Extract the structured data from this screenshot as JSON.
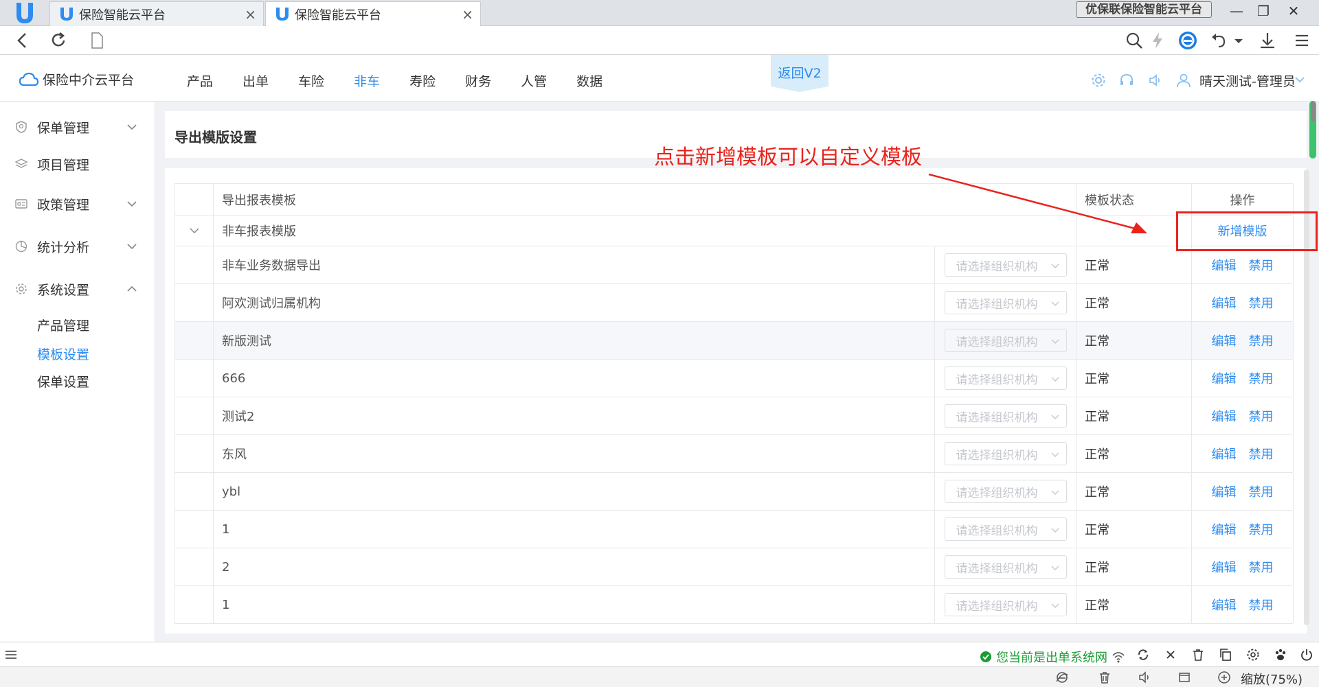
{
  "browser": {
    "tabs": [
      {
        "title": "保险智能云平台",
        "close": "×"
      },
      {
        "title": "保险智能云平台",
        "close": "×"
      }
    ],
    "app_title": "优保联保险智能云平台",
    "window_controls": {
      "minimize": "—",
      "maximize": "❐",
      "close": "✕"
    }
  },
  "header": {
    "brand": "保险中介云平台",
    "nav": [
      "产品",
      "出单",
      "车险",
      "非车",
      "寿险",
      "财务",
      "人管",
      "数据"
    ],
    "active_nav": "非车",
    "return_label": "返回V2",
    "user": "晴天测试-管理员"
  },
  "sidebar": {
    "items": [
      {
        "label": "保单管理",
        "icon": "shield-icon"
      },
      {
        "label": "项目管理",
        "icon": "layers-icon"
      },
      {
        "label": "政策管理",
        "icon": "policy-icon"
      },
      {
        "label": "统计分析",
        "icon": "pie-chart-icon"
      },
      {
        "label": "系统设置",
        "icon": "gear-icon"
      }
    ],
    "sub_items": [
      "产品管理",
      "模板设置",
      "保单设置"
    ],
    "active_sub": "模板设置"
  },
  "page": {
    "title": "导出模版设置",
    "annotation": "点击新增模板可以自定义模板"
  },
  "table": {
    "headers": {
      "name": "导出报表模板",
      "status": "模板状态",
      "ops": "操作"
    },
    "group": {
      "name": "非车报表模版",
      "add_label": "新增模版"
    },
    "select_placeholder": "请选择组织机构",
    "edit_label": "编辑",
    "disable_label": "禁用",
    "rows": [
      {
        "name": "非车业务数据导出",
        "status": "正常"
      },
      {
        "name": "阿欢测试归属机构",
        "status": "正常"
      },
      {
        "name": "新版测试",
        "status": "正常"
      },
      {
        "name": "666",
        "status": "正常"
      },
      {
        "name": "测试2",
        "status": "正常"
      },
      {
        "name": "东风",
        "status": "正常"
      },
      {
        "name": "ybl",
        "status": "正常"
      },
      {
        "name": "1",
        "status": "正常"
      },
      {
        "name": "2",
        "status": "正常"
      },
      {
        "name": "1",
        "status": "正常"
      }
    ]
  },
  "status_bar": {
    "network": "您当前是出单系统网",
    "zoom": "缩放(75%)"
  },
  "colors": {
    "accent": "#2d8cf0",
    "annotation": "#e8231c",
    "status_green": "#1a9c33"
  }
}
